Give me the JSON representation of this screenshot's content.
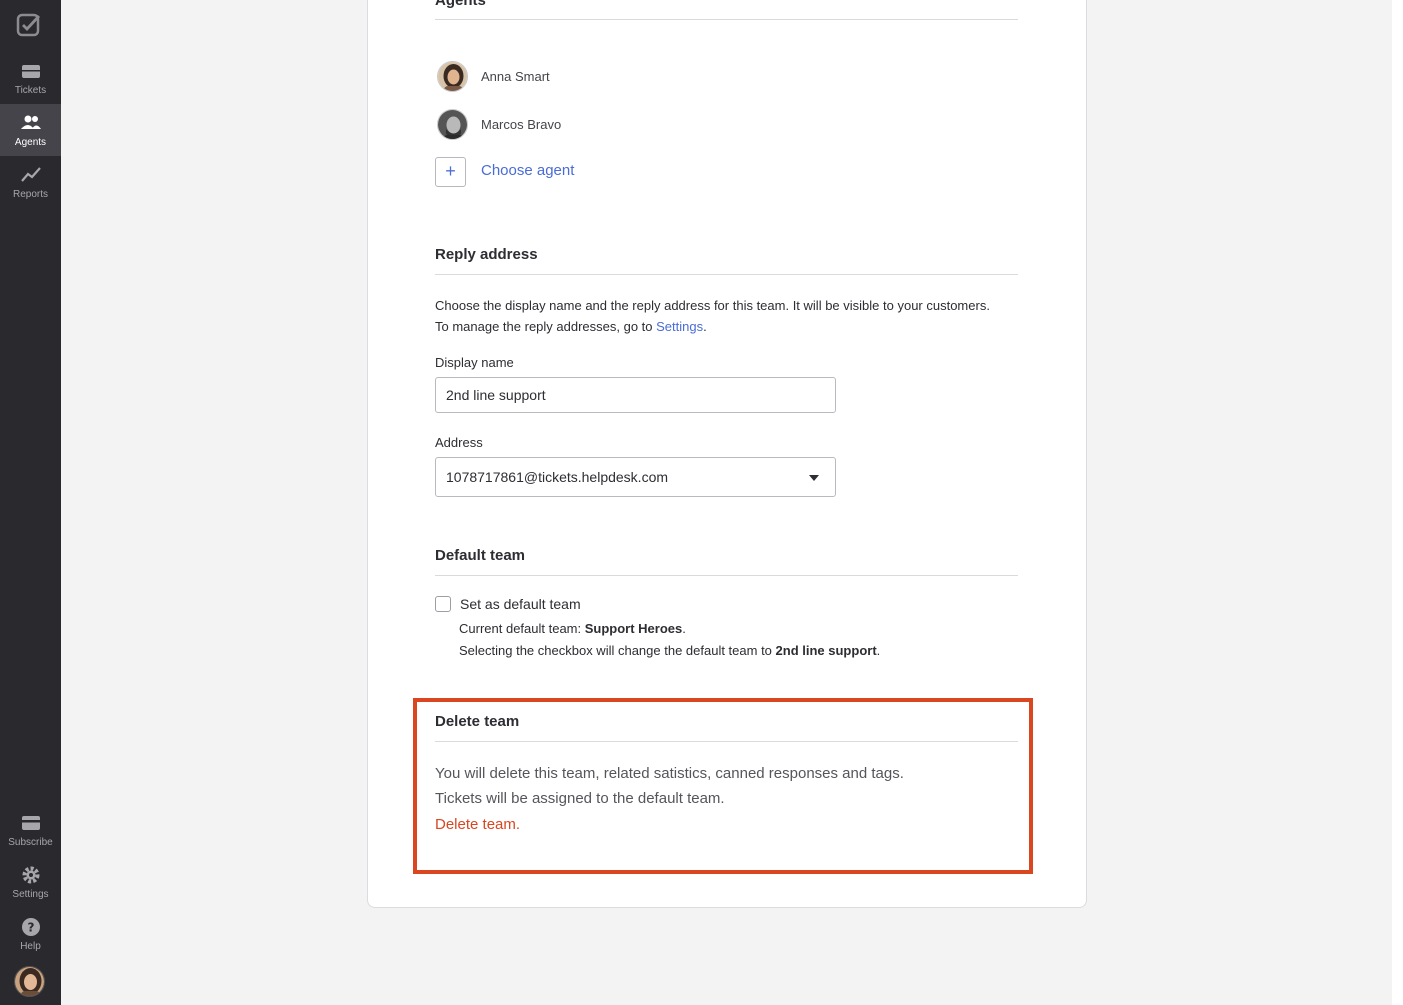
{
  "sidebar": {
    "logo_icon": "checkbox-logo-icon",
    "items": [
      {
        "label": "Tickets",
        "icon": "ticket-icon",
        "active": false
      },
      {
        "label": "Agents",
        "icon": "users-icon",
        "active": true
      },
      {
        "label": "Reports",
        "icon": "chart-line-icon",
        "active": false
      }
    ],
    "bottom_items": [
      {
        "label": "Subscribe",
        "icon": "credit-card-icon"
      },
      {
        "label": "Settings",
        "icon": "gear-icon"
      },
      {
        "label": "Help",
        "icon": "help-icon"
      }
    ]
  },
  "agents_section": {
    "title": "Agents",
    "agents": [
      {
        "name": "Anna Smart"
      },
      {
        "name": "Marcos Bravo"
      }
    ],
    "add_symbol": "+",
    "choose_agent_label": "Choose agent"
  },
  "reply_section": {
    "title": "Reply address",
    "description_line1": "Choose the display name and the reply address for this team. It will be visible to your customers.",
    "description_line2_prefix": "To manage the reply addresses, go to ",
    "settings_link": "Settings",
    "description_line2_suffix": ".",
    "display_name_label": "Display name",
    "display_name_value": "2nd line support",
    "address_label": "Address",
    "address_value": "1078717861@tickets.helpdesk.com"
  },
  "default_team_section": {
    "title": "Default team",
    "checkbox_label": "Set as default team",
    "checked": false,
    "current_prefix": "Current default team: ",
    "current_team": "Support Heroes",
    "current_suffix": ".",
    "change_prefix": "Selecting the checkbox will change the default team to ",
    "change_team": "2nd line support",
    "change_suffix": "."
  },
  "delete_section": {
    "title": "Delete team",
    "line1": "You will delete this team, related satistics, canned responses and tags.",
    "line2": "Tickets will be assigned to the default team.",
    "link": "Delete team.",
    "highlight_color": "#d9461f"
  },
  "colors": {
    "sidebar_bg": "#2a292e",
    "link_blue": "#4a6cd6",
    "danger": "#d9461f"
  }
}
